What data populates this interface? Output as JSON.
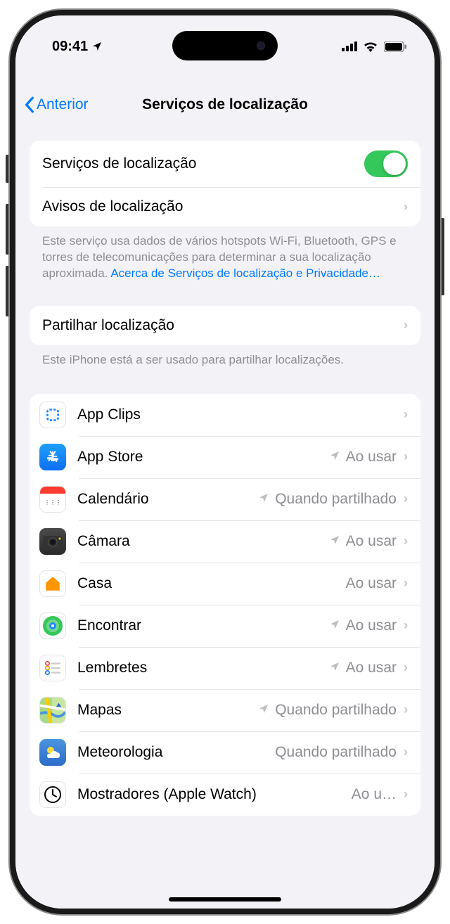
{
  "status": {
    "time": "09:41"
  },
  "nav": {
    "back": "Anterior",
    "title": "Serviços de localização"
  },
  "section1": {
    "location_services": "Serviços de localização",
    "location_alerts": "Avisos de localização",
    "footer_text": "Este serviço usa dados de vários hotspots Wi-Fi, Bluetooth, GPS e torres de telecomunicações para determinar a sua localização aproximada. ",
    "footer_link": "Acerca de Serviços de localização e Privacidade…"
  },
  "section2": {
    "share_location": "Partilhar localização",
    "footer": "Este iPhone está a ser usado para partilhar localizações."
  },
  "apps": [
    {
      "name": "App Clips",
      "status": "",
      "indicator": false,
      "icon": "appclips"
    },
    {
      "name": "App Store",
      "status": "Ao usar",
      "indicator": true,
      "icon": "appstore"
    },
    {
      "name": "Calendário",
      "status": "Quando partilhado",
      "indicator": true,
      "icon": "calendar"
    },
    {
      "name": "Câmara",
      "status": "Ao usar",
      "indicator": true,
      "icon": "camera"
    },
    {
      "name": "Casa",
      "status": "Ao usar",
      "indicator": false,
      "icon": "home"
    },
    {
      "name": "Encontrar",
      "status": "Ao usar",
      "indicator": true,
      "icon": "findmy"
    },
    {
      "name": "Lembretes",
      "status": "Ao usar",
      "indicator": true,
      "icon": "reminders"
    },
    {
      "name": "Mapas",
      "status": "Quando partilhado",
      "indicator": true,
      "icon": "maps"
    },
    {
      "name": "Meteorologia",
      "status": "Quando partilhado",
      "indicator": false,
      "icon": "weather"
    },
    {
      "name": "Mostradores (Apple Watch)",
      "status": "Ao u…",
      "indicator": false,
      "icon": "watch"
    }
  ]
}
